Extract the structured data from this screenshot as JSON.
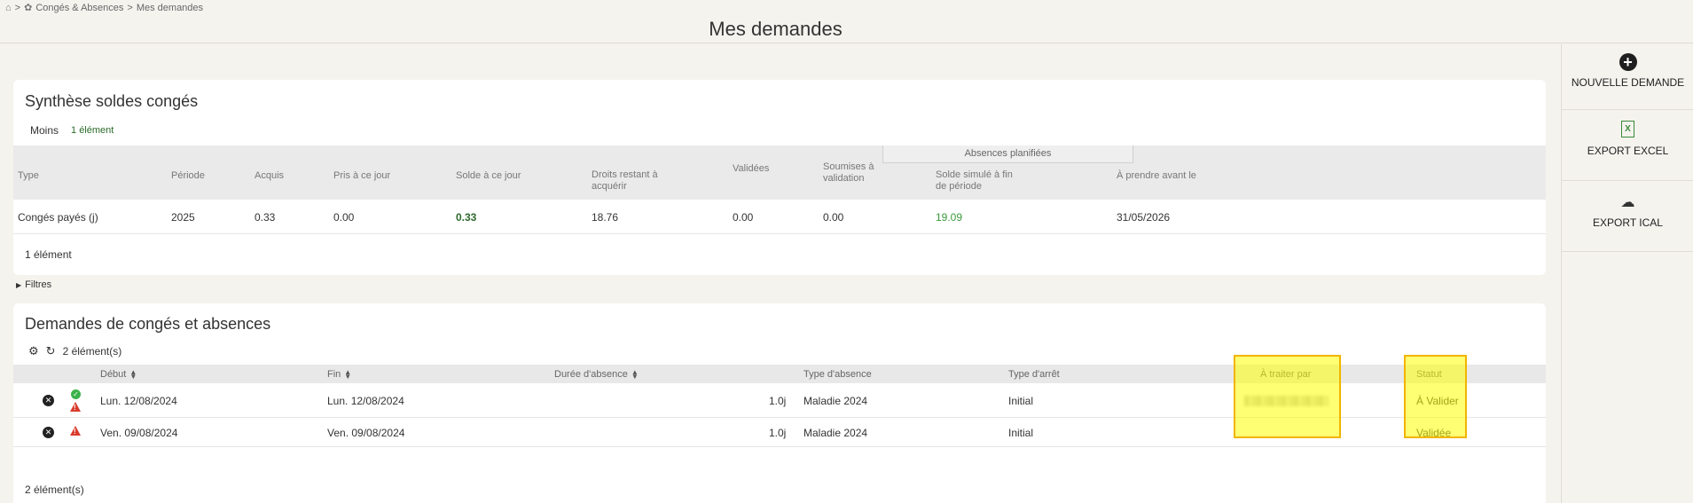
{
  "breadcrumb": {
    "separator": ">",
    "section": "Congés & Absences",
    "current": "Mes demandes"
  },
  "page_title": "Mes demandes",
  "synthese": {
    "title": "Synthèse soldes congés",
    "moins_label": "Moins",
    "count_label": "1 élément",
    "group_header": "Absences planifiées",
    "columns": [
      "Type",
      "Période",
      "Acquis",
      "Pris à ce jour",
      "Solde à ce jour",
      "Droits restant à acquérir",
      "Validées",
      "Soumises à validation",
      "Solde simulé à fin de période",
      "À prendre avant le"
    ],
    "rows": [
      {
        "type": "Congés payés (j)",
        "periode": "2025",
        "acquis": "0.33",
        "pris": "0.00",
        "solde": "0.33",
        "droits": "18.76",
        "validees": "0.00",
        "soumises": "0.00",
        "simule": "19.09",
        "prendre_avant": "31/05/2026"
      }
    ],
    "footer": "1 élément"
  },
  "filtres_label": "Filtres",
  "demandes": {
    "title": "Demandes de congés et absences",
    "count_label": "2 élément(s)",
    "columns": {
      "debut": "Début",
      "fin": "Fin",
      "duree": "Durée d'absence",
      "type_absence": "Type d'absence",
      "type_arret": "Type d'arrêt",
      "a_traiter": "À traiter par",
      "statut": "Statut"
    },
    "rows": [
      {
        "debut": "Lun. 12/08/2024",
        "fin": "Lun. 12/08/2024",
        "duree": "1.0j",
        "type_absence": "Maladie 2024",
        "type_arret": "Initial",
        "statut": "À Valider"
      },
      {
        "debut": "Ven. 09/08/2024",
        "fin": "Ven. 09/08/2024",
        "duree": "1.0j",
        "type_absence": "Maladie 2024",
        "type_arret": "Initial",
        "statut": "Validée"
      }
    ],
    "footer": "2 élément(s)"
  },
  "sidebar": {
    "nouvelle_demande": "NOUVELLE DEMANDE",
    "export_excel": "EXPORT EXCEL",
    "export_ical": "EXPORT ICAL"
  },
  "icons": [
    "home-icon",
    "section-icon",
    "plus-circle-icon",
    "excel-icon",
    "cloud-download-icon",
    "gear-icon",
    "refresh-icon",
    "close-circle-icon",
    "check-circle-icon",
    "warning-icon",
    "sort-icon",
    "triangle-right-icon"
  ],
  "colors": {
    "highlight": "#ffff00",
    "highlight_border": "#f2b400",
    "positive": "#3a9a3a",
    "warning": "#d93a2b"
  }
}
